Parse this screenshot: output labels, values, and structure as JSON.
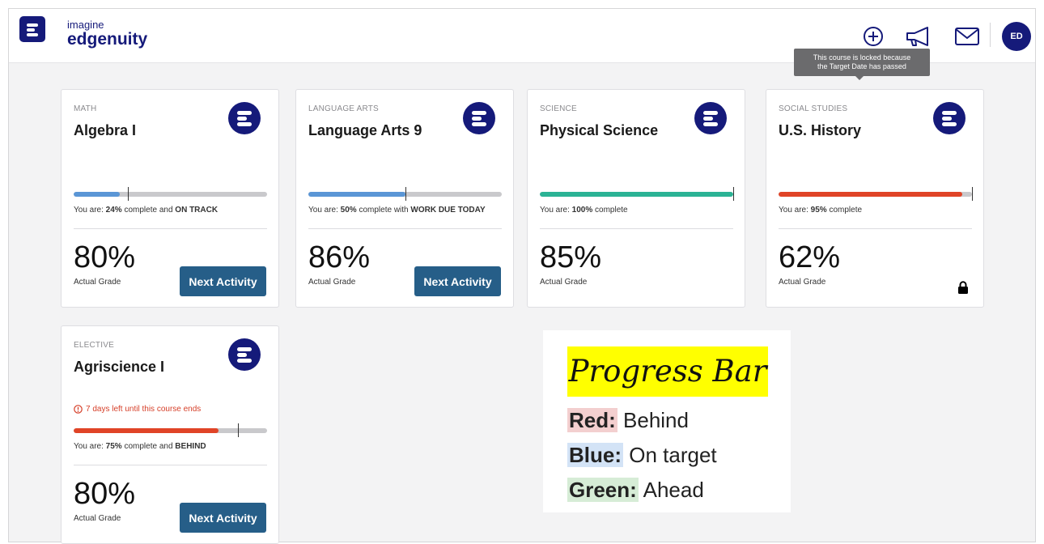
{
  "brand": {
    "top": "imagine",
    "main": "edgenuity"
  },
  "user": {
    "initials": "ED"
  },
  "icons": {
    "add": "plus-circle-icon",
    "announce": "megaphone-icon",
    "mail": "envelope-icon",
    "course": "edgenuity-logo-icon",
    "lock": "lock-icon",
    "warning": "alert-circle-icon"
  },
  "colors": {
    "brand": "#151a7a",
    "button": "#265e88",
    "blue": "#5a96d6",
    "green": "#2bb395",
    "red": "#e04427",
    "track": "#c9c9cc"
  },
  "tooltip": {
    "line1": "This course is locked because",
    "line2": "the Target Date has passed"
  },
  "common": {
    "grade_label": "Actual Grade",
    "next_label": "Next Activity",
    "you_are": "You are:"
  },
  "courses": [
    {
      "subject": "MATH",
      "title": "Algebra I",
      "progress": 24,
      "target": 28,
      "bar_color": "blue",
      "percent": "24%",
      "status_mid": " complete and ",
      "status_tag": "ON TRACK",
      "grade": "80%"
    },
    {
      "subject": "LANGUAGE ARTS",
      "title": "Language Arts 9",
      "progress": 50,
      "target": 50,
      "bar_color": "blue",
      "percent": "50%",
      "status_mid": " complete with ",
      "status_tag": "WORK DUE TODAY",
      "grade": "86%"
    },
    {
      "subject": "SCIENCE",
      "title": "Physical Science",
      "progress": 100,
      "target": 100,
      "bar_color": "green",
      "percent": "100%",
      "status_mid": " complete",
      "status_tag": "",
      "grade": "85%"
    },
    {
      "subject": "SOCIAL STUDIES",
      "title": "U.S. History",
      "progress": 95,
      "target": 100,
      "bar_color": "red",
      "percent": "95%",
      "status_mid": " complete",
      "status_tag": "",
      "grade": "62%",
      "locked": true
    },
    {
      "subject": "ELECTIVE",
      "title": "Agriscience I",
      "progress": 75,
      "target": 85,
      "bar_color": "red",
      "percent": "75%",
      "status_mid": " complete and ",
      "status_tag": "BEHIND",
      "grade": "80%",
      "warning": "7 days left until this course ends"
    }
  ],
  "legend": {
    "title": "Progress Bar",
    "items": [
      {
        "key": "Red:",
        "value": "Behind",
        "highlight": "#f3cfcf"
      },
      {
        "key": "Blue:",
        "value": "On target",
        "highlight": "#d3e3f6"
      },
      {
        "key": "Green:",
        "value": "Ahead",
        "highlight": "#d6ecd6"
      }
    ]
  }
}
